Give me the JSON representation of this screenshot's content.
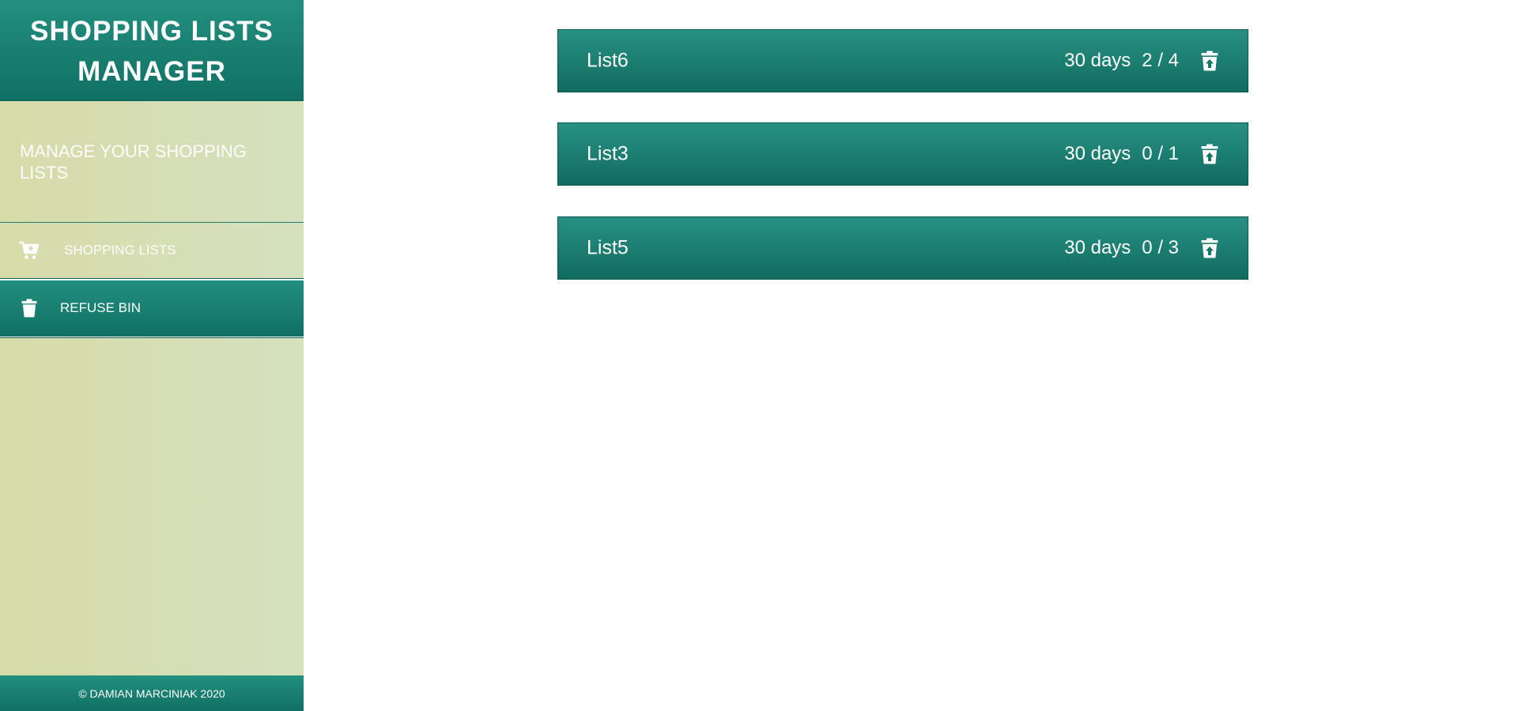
{
  "app": {
    "title": "SHOPPING LISTS MANAGER",
    "tagline": "MANAGE YOUR SHOPPING LISTS",
    "footer": "© DAMIAN MARCINIAK 2020"
  },
  "nav": {
    "items": [
      {
        "label": "SHOPPING LISTS",
        "icon": "cart-icon",
        "active": false
      },
      {
        "label": "REFUSE BIN",
        "icon": "trash-icon",
        "active": true
      }
    ]
  },
  "lists": [
    {
      "name": "List6",
      "days": "30 days",
      "count": "2 / 4",
      "action_icon": "restore-from-trash-icon"
    },
    {
      "name": "List3",
      "days": "30 days",
      "count": "0 / 1",
      "action_icon": "restore-from-trash-icon"
    },
    {
      "name": "List5",
      "days": "30 days",
      "count": "0 / 3",
      "action_icon": "restore-from-trash-icon"
    }
  ],
  "colors": {
    "accent": "#1a7f71",
    "accent_dark": "#0b5a4f",
    "sidebar": "#d5dcb0",
    "text_light": "#ffffff"
  }
}
